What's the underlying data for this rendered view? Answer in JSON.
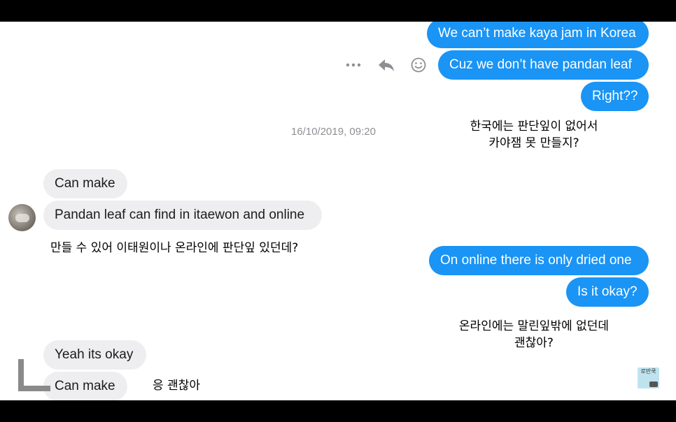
{
  "thread": {
    "outgoing_top": [
      {
        "text": "We can’t make kaya jam in Korea"
      },
      {
        "text": "Cuz we don’t have pandan leaf"
      },
      {
        "text": "Right??"
      }
    ],
    "caption_top_line1": "한국에는 판단잎이 없어서",
    "caption_top_line2": "카야잼 못 만들지?",
    "timestamp": "16/10/2019, 09:20",
    "incoming_mid": [
      {
        "text": "Can make"
      },
      {
        "text": "Pandan leaf can find in itaewon and online"
      }
    ],
    "caption_mid": "만들 수 있어 이태원이나 온라인에 판단잎 있던데?",
    "outgoing_mid": [
      {
        "text": "On online there is only dried one"
      },
      {
        "text": "Is it okay?"
      }
    ],
    "caption_mid2_line1": "온라인에는 말린잎밖에 없던데",
    "caption_mid2_line2": "괜찮아?",
    "incoming_bottom": [
      {
        "text": "Yeah its okay"
      },
      {
        "text": "Can make"
      }
    ],
    "caption_bottom": "응 괜찮아"
  },
  "watermark": {
    "text": "로반쿡"
  },
  "icons": {
    "more": "more-dots-icon",
    "reply": "reply-arrow-icon",
    "react": "smiley-icon"
  },
  "colors": {
    "outgoing_bubble": "#1a94f5",
    "incoming_bubble": "#eeeef0",
    "letterbox": "#000000"
  }
}
